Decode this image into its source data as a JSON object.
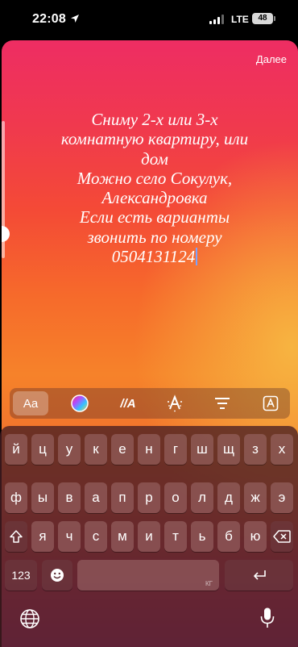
{
  "status_bar": {
    "time": "22:08",
    "network": "LTE",
    "battery": "48"
  },
  "story": {
    "done_label": "Далее",
    "text": "Сниму 2-х или 3-х\nкомнатную квартиру, или\nдом\nМожно село Сокулук,\nАлександровка\nЕсли есть варианты\nзвонить по номеру\n0504131124"
  },
  "toolbar": {
    "font_label": "Aa",
    "animation_label": "//A",
    "tools": [
      "font-style",
      "color",
      "animation",
      "effect",
      "align",
      "background"
    ]
  },
  "keyboard": {
    "rows": [
      [
        "й",
        "ц",
        "у",
        "к",
        "е",
        "н",
        "г",
        "ш",
        "щ",
        "з",
        "х"
      ],
      [
        "ф",
        "ы",
        "в",
        "а",
        "п",
        "р",
        "о",
        "л",
        "д",
        "ж",
        "э"
      ],
      [
        "я",
        "ч",
        "с",
        "м",
        "и",
        "т",
        "ь",
        "б",
        "ю"
      ]
    ],
    "numbers_label": "123",
    "space_sub_label": "КГ",
    "icons": [
      "shift-icon",
      "backspace-icon",
      "emoji-icon",
      "return-icon",
      "globe-icon",
      "microphone-icon"
    ]
  }
}
